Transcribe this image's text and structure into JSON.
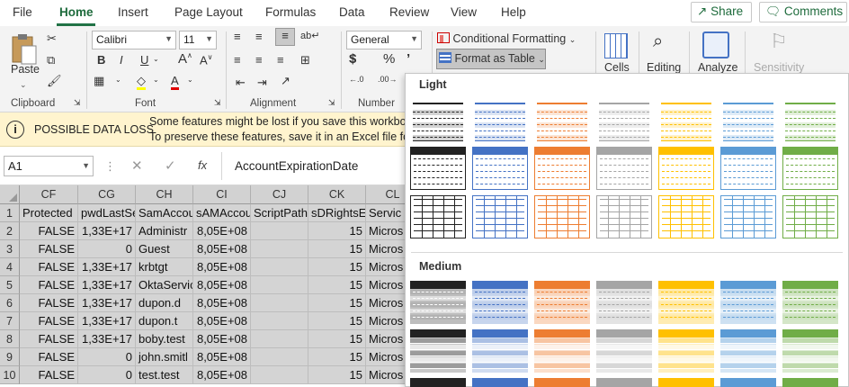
{
  "tabs": [
    {
      "label": "File"
    },
    {
      "label": "Home",
      "active": true
    },
    {
      "label": "Insert"
    },
    {
      "label": "Page Layout"
    },
    {
      "label": "Formulas"
    },
    {
      "label": "Data"
    },
    {
      "label": "Review"
    },
    {
      "label": "View"
    },
    {
      "label": "Help"
    }
  ],
  "share_label": "Share",
  "comments_label": "Comments",
  "ribbon": {
    "clipboard": {
      "label": "Clipboard",
      "paste": "Paste"
    },
    "font": {
      "label": "Font",
      "name": "Calibri",
      "size": "11",
      "bold": "B",
      "italic": "I",
      "underline": "U"
    },
    "alignment": {
      "label": "Alignment"
    },
    "number": {
      "label": "Number",
      "format": "General"
    },
    "styles": {
      "conditional": "Conditional Formatting",
      "format_table": "Format as Table"
    },
    "cells": {
      "label": "Cells"
    },
    "editing": {
      "label": "Editing"
    },
    "analyze": {
      "label": "Analyze"
    },
    "sensitivity": {
      "label": "Sensitivity"
    }
  },
  "infobar": {
    "title": "POSSIBLE DATA LOSS",
    "line1": "Some features might be lost if you save this workbook",
    "line2": "To preserve these features, save it in an Excel file forma"
  },
  "formula_bar": {
    "name_box": "A1",
    "fx": "fx",
    "content": "AccountExpirationDate"
  },
  "grid": {
    "columns": [
      "CF",
      "CG",
      "CH",
      "CI",
      "CJ",
      "CK",
      "CL"
    ],
    "rows": [
      {
        "n": "1",
        "cells": [
          "Protected",
          "pwdLastSe",
          "SamAccou",
          "sAMAccou",
          "ScriptPath",
          "sDRightsE",
          "Servic"
        ]
      },
      {
        "n": "2",
        "cells": [
          "FALSE",
          "1,33E+17",
          "Administr",
          "8,05E+08",
          "",
          "15",
          "Micros"
        ]
      },
      {
        "n": "3",
        "cells": [
          "FALSE",
          "0",
          "Guest",
          "8,05E+08",
          "",
          "15",
          "Micros"
        ]
      },
      {
        "n": "4",
        "cells": [
          "FALSE",
          "1,33E+17",
          "krbtgt",
          "8,05E+08",
          "",
          "15",
          "Micros"
        ]
      },
      {
        "n": "5",
        "cells": [
          "FALSE",
          "1,33E+17",
          "OktaServic",
          "8,05E+08",
          "",
          "15",
          "Micros"
        ]
      },
      {
        "n": "6",
        "cells": [
          "FALSE",
          "1,33E+17",
          "dupon.d",
          "8,05E+08",
          "",
          "15",
          "Micros"
        ]
      },
      {
        "n": "7",
        "cells": [
          "FALSE",
          "1,33E+17",
          "dupon.t",
          "8,05E+08",
          "",
          "15",
          "Micros"
        ]
      },
      {
        "n": "8",
        "cells": [
          "FALSE",
          "1,33E+17",
          "boby.test",
          "8,05E+08",
          "",
          "15",
          "Micros"
        ]
      },
      {
        "n": "9",
        "cells": [
          "FALSE",
          "0",
          "john.smitl",
          "8,05E+08",
          "",
          "15",
          "Micros"
        ]
      },
      {
        "n": "10",
        "cells": [
          "FALSE",
          "0",
          "test.test",
          "8,05E+08",
          "",
          "15",
          "Micros"
        ]
      }
    ]
  },
  "gallery": {
    "light_label": "Light",
    "medium_label": "Medium",
    "style_colors": [
      "#222222",
      "#4472c4",
      "#ed7d31",
      "#a5a5a5",
      "#ffc000",
      "#5b9bd5",
      "#70ad47"
    ]
  },
  "colors": {
    "accent": "#217346",
    "info_bg": "#fff4ce",
    "header_bg": "#d2d2d2"
  }
}
